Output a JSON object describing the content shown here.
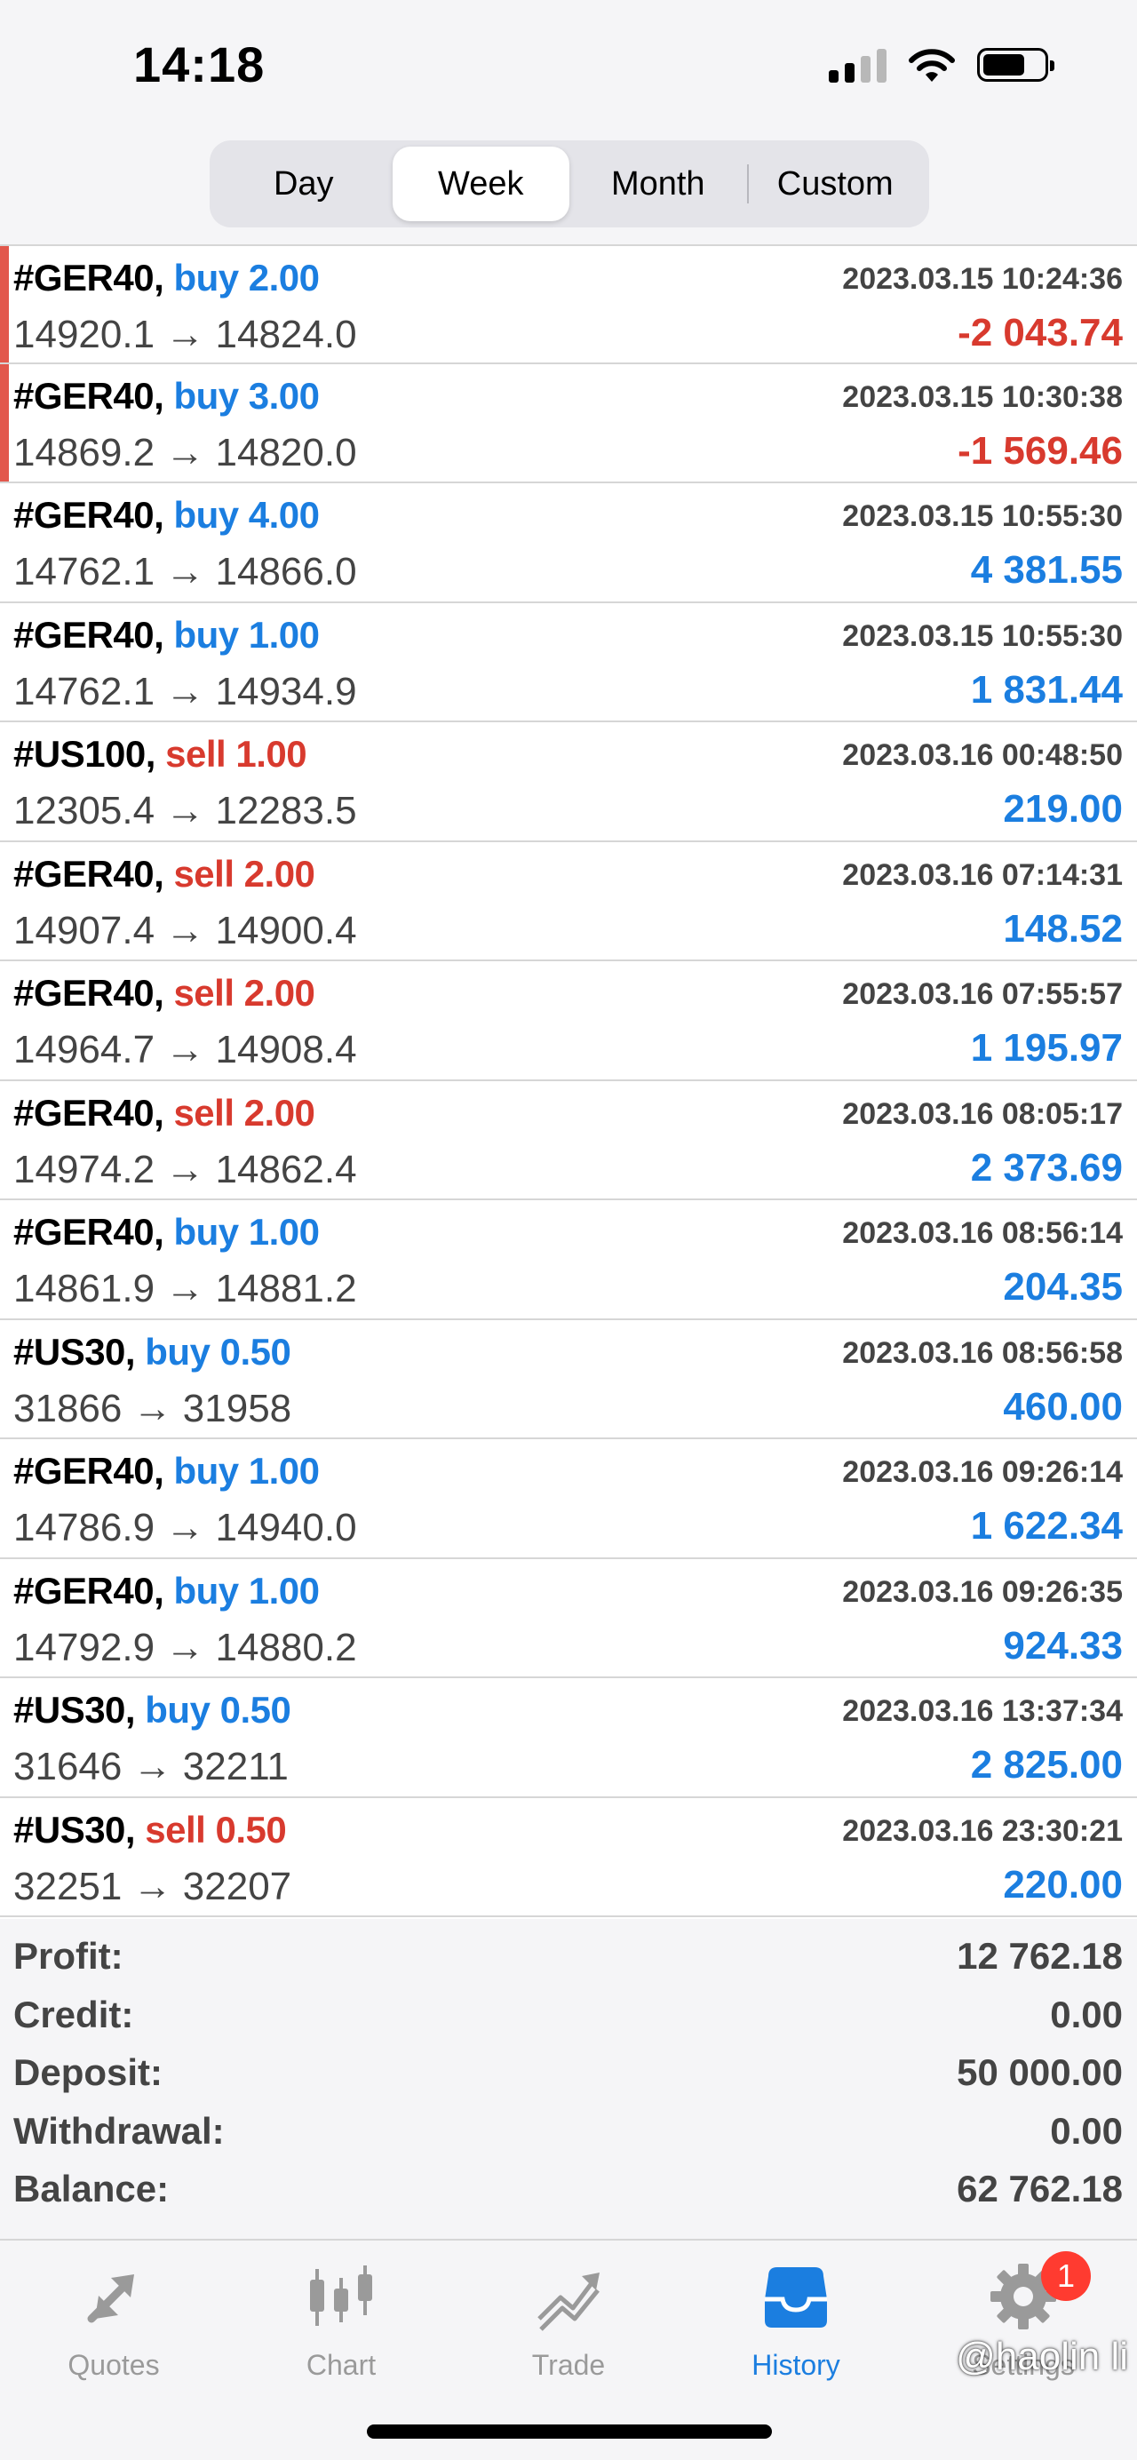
{
  "status": {
    "time": "14:18"
  },
  "periods": [
    {
      "label": "Day",
      "active": false
    },
    {
      "label": "Week",
      "active": true
    },
    {
      "label": "Month",
      "active": false
    },
    {
      "label": "Custom",
      "active": false
    }
  ],
  "deals": [
    {
      "symbol": "#GER40,",
      "direction": "buy",
      "volume": "2.00",
      "time": "2023.03.15 10:24:36",
      "prices": "14920.1 → 14824.0",
      "profit": "-2 043.74",
      "loss": true
    },
    {
      "symbol": "#GER40,",
      "direction": "buy",
      "volume": "3.00",
      "time": "2023.03.15 10:30:38",
      "prices": "14869.2 → 14820.0",
      "profit": "-1 569.46",
      "loss": true
    },
    {
      "symbol": "#GER40,",
      "direction": "buy",
      "volume": "4.00",
      "time": "2023.03.15 10:55:30",
      "prices": "14762.1 → 14866.0",
      "profit": "4 381.55",
      "loss": false
    },
    {
      "symbol": "#GER40,",
      "direction": "buy",
      "volume": "1.00",
      "time": "2023.03.15 10:55:30",
      "prices": "14762.1 → 14934.9",
      "profit": "1 831.44",
      "loss": false
    },
    {
      "symbol": "#US100,",
      "direction": "sell",
      "volume": "1.00",
      "time": "2023.03.16 00:48:50",
      "prices": "12305.4 → 12283.5",
      "profit": "219.00",
      "loss": false
    },
    {
      "symbol": "#GER40,",
      "direction": "sell",
      "volume": "2.00",
      "time": "2023.03.16 07:14:31",
      "prices": "14907.4 → 14900.4",
      "profit": "148.52",
      "loss": false
    },
    {
      "symbol": "#GER40,",
      "direction": "sell",
      "volume": "2.00",
      "time": "2023.03.16 07:55:57",
      "prices": "14964.7 → 14908.4",
      "profit": "1 195.97",
      "loss": false
    },
    {
      "symbol": "#GER40,",
      "direction": "sell",
      "volume": "2.00",
      "time": "2023.03.16 08:05:17",
      "prices": "14974.2 → 14862.4",
      "profit": "2 373.69",
      "loss": false
    },
    {
      "symbol": "#GER40,",
      "direction": "buy",
      "volume": "1.00",
      "time": "2023.03.16 08:56:14",
      "prices": "14861.9 → 14881.2",
      "profit": "204.35",
      "loss": false
    },
    {
      "symbol": "#US30,",
      "direction": "buy",
      "volume": "0.50",
      "time": "2023.03.16 08:56:58",
      "prices": "31866 → 31958",
      "profit": "460.00",
      "loss": false
    },
    {
      "symbol": "#GER40,",
      "direction": "buy",
      "volume": "1.00",
      "time": "2023.03.16 09:26:14",
      "prices": "14786.9 → 14940.0",
      "profit": "1 622.34",
      "loss": false
    },
    {
      "symbol": "#GER40,",
      "direction": "buy",
      "volume": "1.00",
      "time": "2023.03.16 09:26:35",
      "prices": "14792.9 → 14880.2",
      "profit": "924.33",
      "loss": false
    },
    {
      "symbol": "#US30,",
      "direction": "buy",
      "volume": "0.50",
      "time": "2023.03.16 13:37:34",
      "prices": "31646 → 32211",
      "profit": "2 825.00",
      "loss": false
    },
    {
      "symbol": "#US30,",
      "direction": "sell",
      "volume": "0.50",
      "time": "2023.03.16 23:30:21",
      "prices": "32251 → 32207",
      "profit": "220.00",
      "loss": false
    }
  ],
  "summary": [
    {
      "label": "Profit:",
      "value": "12 762.18"
    },
    {
      "label": "Credit:",
      "value": "0.00"
    },
    {
      "label": "Deposit:",
      "value": "50 000.00"
    },
    {
      "label": "Withdrawal:",
      "value": "0.00"
    },
    {
      "label": "Balance:",
      "value": "62 762.18"
    }
  ],
  "tabs": [
    {
      "label": "Quotes",
      "icon": "quotes-icon",
      "active": false
    },
    {
      "label": "Chart",
      "icon": "chart-icon",
      "active": false
    },
    {
      "label": "Trade",
      "icon": "trade-icon",
      "active": false
    },
    {
      "label": "History",
      "icon": "history-icon",
      "active": true
    },
    {
      "label": "Settings",
      "icon": "gear-icon",
      "active": false,
      "badge": "1"
    }
  ],
  "watermark": "@haolin li",
  "colors": {
    "buy": "#1b7ee0",
    "sell": "#d83a2e",
    "loss_marker": "#e2574c",
    "badge": "#ff3b30"
  }
}
